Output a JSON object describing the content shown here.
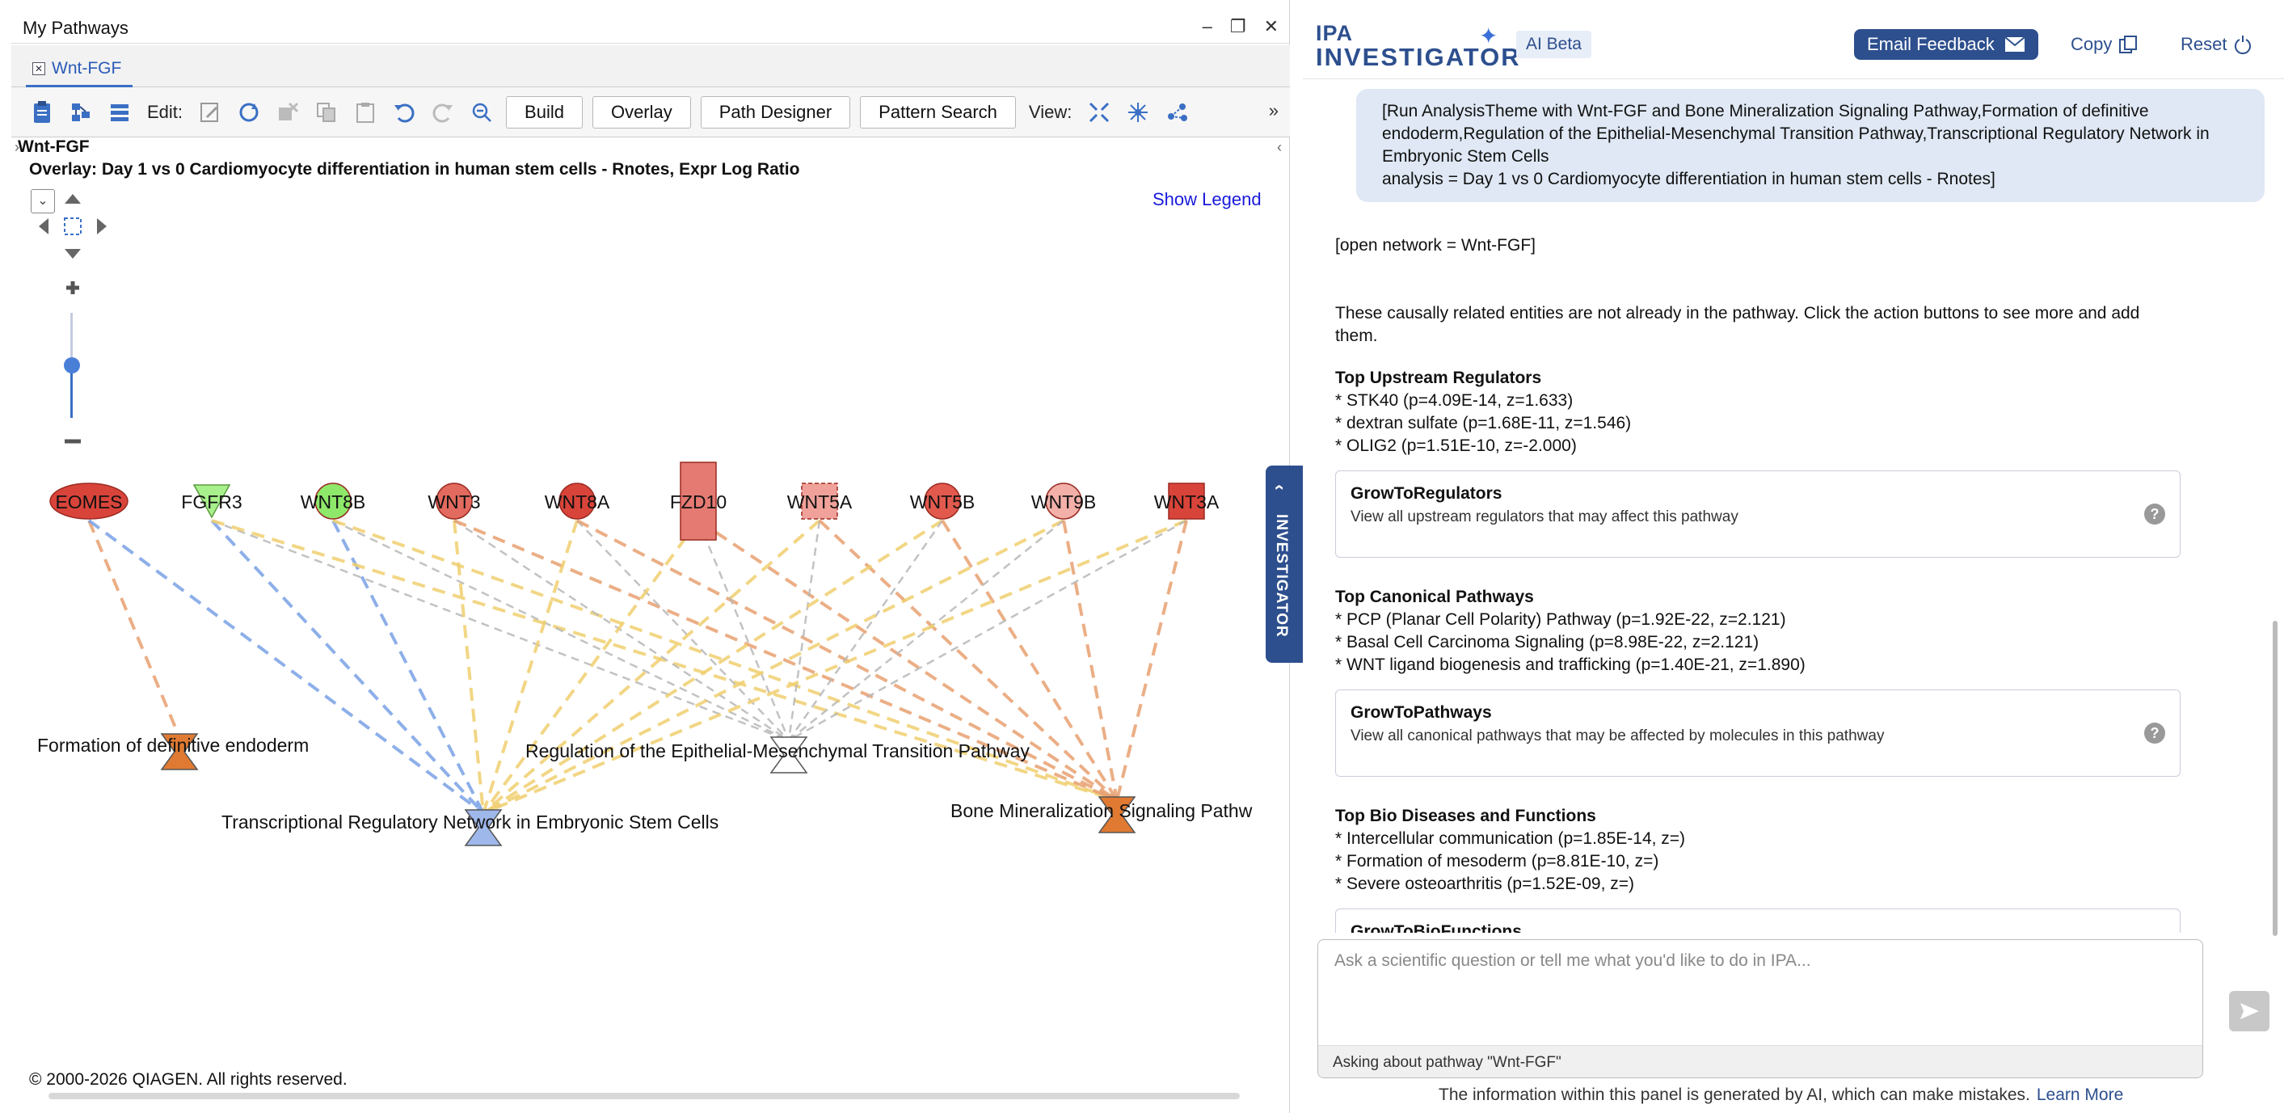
{
  "left_panel": {
    "title": "My Pathways",
    "tab_label": "Wnt-FGF",
    "toolbar": {
      "edit_label": "Edit:",
      "view_label": "View:",
      "buttons": [
        "Build",
        "Overlay",
        "Path Designer",
        "Pattern Search"
      ],
      "more": "»"
    },
    "network_title": "Wnt-FGF",
    "overlay_label": "Overlay: Day 1 vs 0 Cardiomyocyte differentiation in human stem cells - Rnotes, Expr Log Ratio",
    "show_legend": "Show Legend",
    "copyright": "© 2000-2026 QIAGEN. All rights reserved.",
    "molecules": [
      {
        "label": "EOMES",
        "shape": "ellipse",
        "color": "#d9443a"
      },
      {
        "label": "FGFR3",
        "shape": "triangle-down",
        "color": "#a8f08c"
      },
      {
        "label": "WNT8B",
        "shape": "circle",
        "color": "#8ee86a"
      },
      {
        "label": "WNT3",
        "shape": "circle",
        "color": "#e26a5e"
      },
      {
        "label": "WNT8A",
        "shape": "circle",
        "color": "#d9443a"
      },
      {
        "label": "FZD10",
        "shape": "rect-tall",
        "color": "#e57a72"
      },
      {
        "label": "WNT5A",
        "shape": "rect-dashed",
        "color": "#f0a29a"
      },
      {
        "label": "WNT5B",
        "shape": "circle",
        "color": "#e25a4e"
      },
      {
        "label": "WNT9B",
        "shape": "circle",
        "color": "#f2b0a8"
      },
      {
        "label": "WNT3A",
        "shape": "square",
        "color": "#d9443a"
      }
    ],
    "pathways": [
      {
        "label": "Formation of definitive endoderm",
        "color": "#e07a32"
      },
      {
        "label": "Transcriptional Regulatory Network in Embryonic Stem Cells",
        "color": "#9fb8ec"
      },
      {
        "label": "Regulation of the Epithelial-Mesenchymal Transition Pathway",
        "color": "#ffffff"
      },
      {
        "label": "Bone Mineralization Signaling Pathw",
        "color": "#e07a32"
      }
    ],
    "investigator_tab": "INVESTIGATOR"
  },
  "right_panel": {
    "brand_top": "IPA",
    "brand_bottom": "INVESTIGATOR",
    "ai_badge": "AI Beta",
    "email_feedback": "Email Feedback",
    "copy": "Copy",
    "reset": "Reset",
    "request_bubble": [
      "[Run AnalysisTheme with Wnt-FGF and Bone Mineralization Signaling Pathway,Formation of definitive",
      "endoderm,Regulation of the Epithelial-Mesenchymal Transition Pathway,Transcriptional Regulatory Network in",
      "Embryonic Stem Cells",
      "analysis = Day 1 vs 0 Cardiomyocyte differentiation in human stem cells - Rnotes]"
    ],
    "open_network": "[open network = Wnt-FGF]",
    "intro": [
      "These causally related entities are not already in the pathway. Click the action buttons to see more and add",
      "them."
    ],
    "sections": [
      {
        "title": "Top Upstream Regulators",
        "items": [
          "* STK40 (p=4.09E-14, z=1.633)",
          "* dextran sulfate (p=1.68E-11, z=1.546)",
          "* OLIG2 (p=1.51E-10, z=-2.000)"
        ],
        "card_title": "GrowToRegulators",
        "card_desc": "View all upstream regulators that may affect this pathway"
      },
      {
        "title": "Top Canonical Pathways",
        "items": [
          "* PCP (Planar Cell Polarity) Pathway (p=1.92E-22, z=2.121)",
          "* Basal Cell Carcinoma Signaling (p=8.98E-22, z=2.121)",
          "* WNT ligand biogenesis and trafficking (p=1.40E-21, z=1.890)"
        ],
        "card_title": "GrowToPathways",
        "card_desc": "View all canonical pathways that may be affected by molecules in this pathway"
      },
      {
        "title": "Top Bio Diseases and Functions",
        "items": [
          "* Intercellular communication (p=1.85E-14, z=)",
          "* Formation of mesoderm (p=8.81E-10, z=)",
          "* Severe osteoarthritis (p=1.52E-09, z=)"
        ],
        "card_title": "GrowToBioFunctions",
        "card_desc": ""
      }
    ],
    "input_placeholder": "Ask a scientific question or tell me what you'd like to do in IPA...",
    "input_context": "Asking about pathway \"Wnt-FGF\"",
    "disclaimer": "The information within this panel is generated by AI, which can make mistakes.",
    "learn_more": "Learn More"
  }
}
